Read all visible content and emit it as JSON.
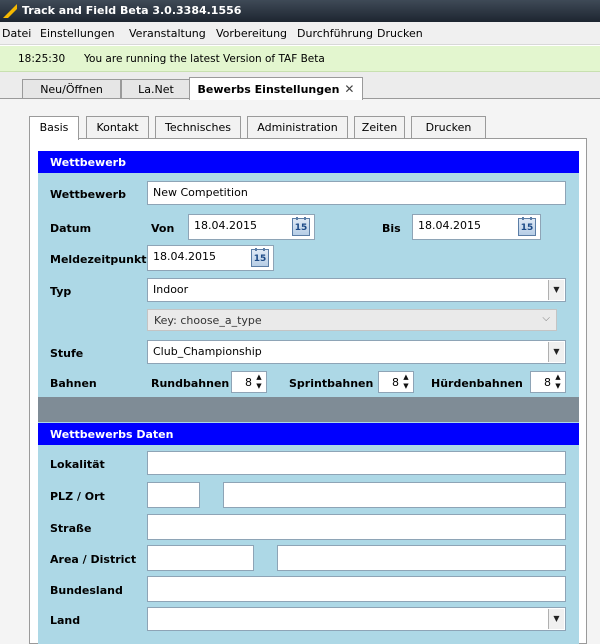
{
  "window": {
    "title": "Track and Field Beta 3.0.3384.1556"
  },
  "menu": [
    "Datei",
    "Einstellungen",
    "Veranstaltung",
    "Vorbereitung",
    "Durchführung",
    "Drucken"
  ],
  "status": {
    "time": "18:25:30",
    "message": "You are running the latest Version of TAF Beta"
  },
  "doc_tabs": [
    {
      "label": "Neu/Öffnen"
    },
    {
      "label": "La.Net"
    },
    {
      "label": "Bewerbs Einstellungen",
      "close": "✕"
    }
  ],
  "inner_tabs": [
    "Basis",
    "Kontakt",
    "Technisches",
    "Administration",
    "Zeiten",
    "Drucken"
  ],
  "section1": {
    "header": "Wettbewerb",
    "wettbewerb_label": "Wettbewerb",
    "wettbewerb_value": "New Competition",
    "datum_label": "Datum",
    "von_label": "Von",
    "von_value": "18.04.2015",
    "bis_label": "Bis",
    "bis_value": "18.04.2015",
    "calendar_day": "15",
    "meldezeit_label": "Meldezeitpunkt",
    "meldezeit_value": "18.04.2015",
    "typ_label": "Typ",
    "typ_value": "Indoor",
    "key_value": "Key: choose_a_type",
    "stufe_label": "Stufe",
    "stufe_value": "Club_Championship",
    "bahnen_label": "Bahnen",
    "rundbahnen_label": "Rundbahnen",
    "rundbahnen_value": "8",
    "sprintbahnen_label": "Sprintbahnen",
    "sprintbahnen_value": "8",
    "huerdenbahnen_label": "Hürdenbahnen",
    "huerdenbahnen_value": "8"
  },
  "section2": {
    "header": "Wettbewerbs Daten",
    "lokalitaet_label": "Lokalität",
    "plz_label": "PLZ / Ort",
    "strasse_label": "Straße",
    "area_label": "Area / District",
    "bundesland_label": "Bundesland",
    "land_label": "Land"
  },
  "icons": {
    "dropdown": "▼",
    "chevron": "⌵",
    "spin_up": "▲",
    "spin_down": "▼"
  },
  "colors": {
    "section_header": "#0000ff",
    "panel": "#add8e6",
    "status_bg": "#e3f6cf"
  }
}
